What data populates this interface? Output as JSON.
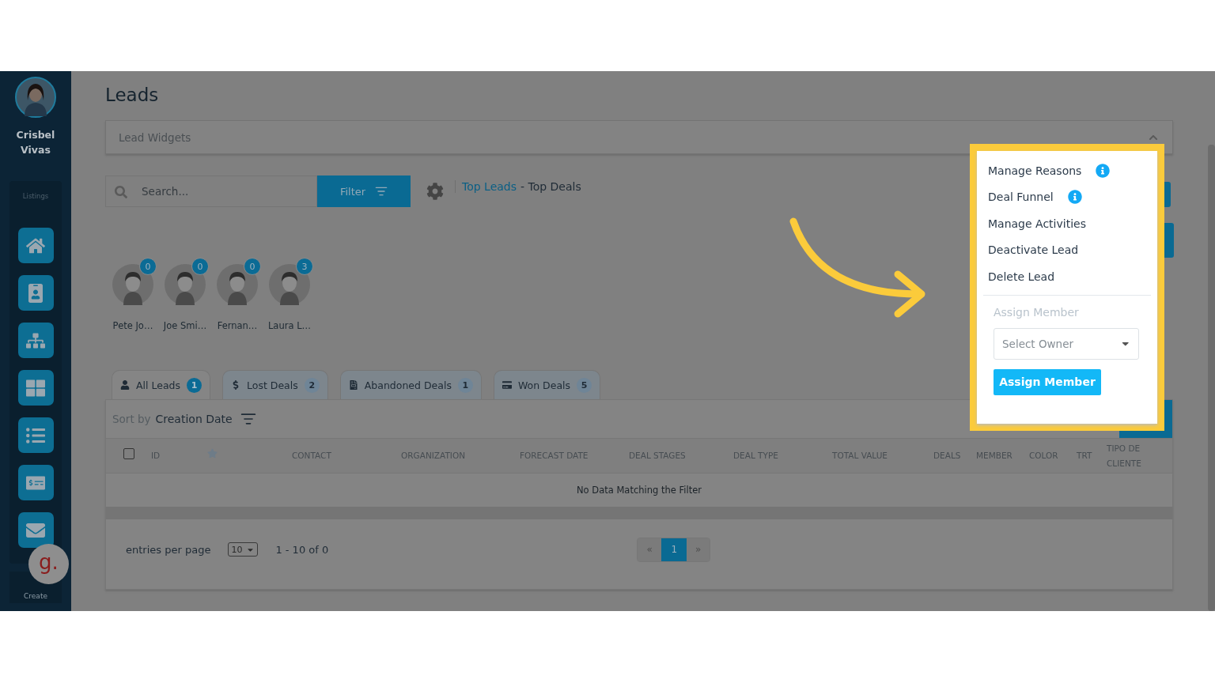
{
  "sidebar": {
    "user_name": "Crisbel Vivas",
    "section_label": "Listings",
    "create_label": "Create",
    "logo_text": "g."
  },
  "page_title": "Leads",
  "widgets_panel": {
    "title": "Lead Widgets",
    "expanded": true
  },
  "search": {
    "placeholder": "Search..."
  },
  "filter_button": "Filter",
  "breadcrumb": {
    "link": "Top Leads",
    "rest": "- Top Deals"
  },
  "agents": [
    {
      "name": "Pete Jo…",
      "count": "0"
    },
    {
      "name": "Joe Smi…",
      "count": "0"
    },
    {
      "name": "Fernan…",
      "count": "0"
    },
    {
      "name": "Laura L…",
      "count": "3"
    }
  ],
  "tabs": [
    {
      "label": "All Leads",
      "count": "1",
      "selected": true
    },
    {
      "label": "Lost Deals",
      "count": "2",
      "selected": false
    },
    {
      "label": "Abandoned Deals",
      "count": "1",
      "selected": false
    },
    {
      "label": "Won Deals",
      "count": "5",
      "selected": false
    }
  ],
  "sort": {
    "prefix": "Sort by",
    "field": "Creation Date"
  },
  "table": {
    "columns": [
      {
        "kind": "checkbox",
        "checked": false
      },
      {
        "kind": "text",
        "label": "ID"
      },
      {
        "kind": "star"
      },
      {
        "kind": "text",
        "label": "CONTACT"
      },
      {
        "kind": "text",
        "label": "ORGANIZATION"
      },
      {
        "kind": "text",
        "label": "FORECAST DATE"
      },
      {
        "kind": "text",
        "label": "DEAL STAGES"
      },
      {
        "kind": "text",
        "label": "DEAL TYPE"
      },
      {
        "kind": "text",
        "label": "TOTAL VALUE"
      },
      {
        "kind": "text",
        "label": "DEALS"
      },
      {
        "kind": "text",
        "label": "MEMBER"
      },
      {
        "kind": "text",
        "label": "COLOR"
      },
      {
        "kind": "text",
        "label": "TRT"
      },
      {
        "kind": "text",
        "label": "TIPO DE CLIENTE"
      }
    ],
    "empty_message": "No Data Matching the Filter"
  },
  "pagination": {
    "entries_label": "entries per page",
    "page_size": "10",
    "range": "1 - 10 of 0",
    "prev": "«",
    "next": "»",
    "pages": [
      {
        "label": "1",
        "selected": true
      }
    ]
  },
  "menu": {
    "items": [
      {
        "label": "Manage Reasons",
        "info": true
      },
      {
        "label": "Deal Funnel",
        "info": true
      },
      {
        "label": "Manage Activities",
        "info": false
      },
      {
        "label": "Deactivate Lead",
        "info": false
      },
      {
        "label": "Delete Lead",
        "info": false
      }
    ],
    "assign_heading": "Assign Member",
    "owner_select": {
      "placeholder": "Select Owner"
    },
    "assign_button": "Assign Member"
  }
}
